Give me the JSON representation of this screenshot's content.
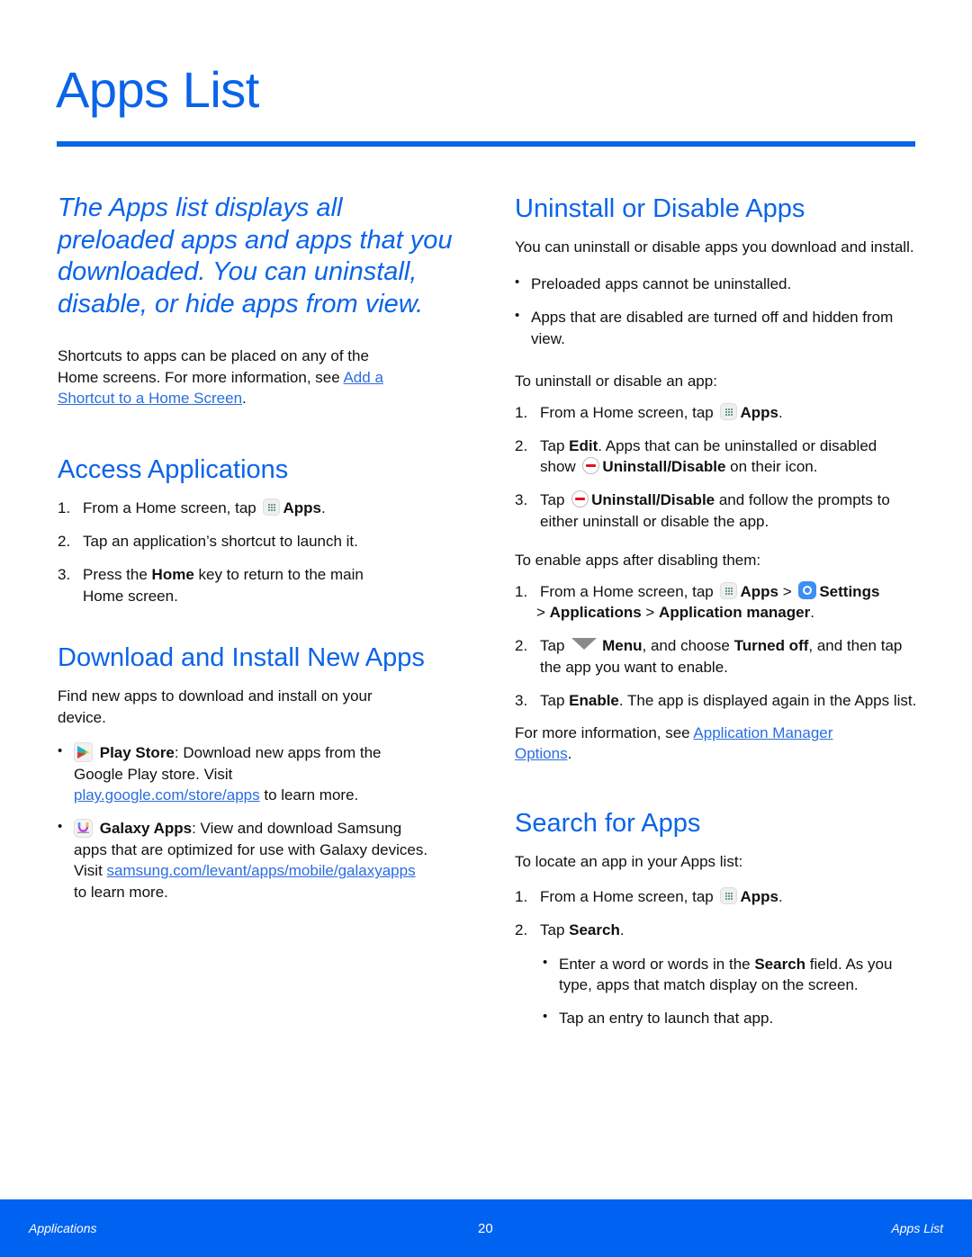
{
  "page": {
    "title": "Apps List",
    "accent_color": "#0a64e8",
    "intro": "The Apps list displays all preloaded apps and apps that you downloaded. You can uninstall, disable, or hide apps from view.",
    "shortcut_text_1": "Shortcuts to apps can be placed on any of the Home screens. For more information, see ",
    "shortcut_link": "Add a Shortcut to a Home Screen",
    "shortcut_text_2": "."
  },
  "access": {
    "heading": "Access Applications",
    "steps": [
      {
        "num": "1.",
        "pre": "From a Home screen, tap ",
        "icon": "apps-grid-icon",
        "bold": "Apps",
        "post": "."
      },
      {
        "num": "2.",
        "text": "Tap an application’s shortcut to launch it."
      },
      {
        "num": "3.",
        "pre": "Press the ",
        "bold": "Home",
        "post": " key to return to the main Home screen."
      }
    ]
  },
  "download": {
    "heading": "Download and Install New Apps",
    "text": "Find new apps to download and install on your device.",
    "items": [
      {
        "icon": "play-store-icon",
        "bold": "Play Store",
        "text": ": Download new apps from the Google Play store. Visit ",
        "link": "play.google.com/store/apps",
        "post": " to learn more."
      },
      {
        "icon": "galaxy-apps-icon",
        "bold": "Galaxy Apps",
        "text": ": View and download Samsung apps that are optimized for use with Galaxy devices. Visit ",
        "link": "samsung.com/levant/apps/mobile/galaxyapps",
        "post": " to learn more."
      }
    ]
  },
  "uninstall": {
    "heading": "Uninstall or Disable Apps",
    "text": "You can uninstall or disable apps you download and install.",
    "bullets": [
      "Preloaded apps cannot be uninstalled.",
      "Apps that are disabled are turned off and hidden from view."
    ],
    "intro_steps": "To uninstall or disable an app:",
    "steps": [
      {
        "num": "1.",
        "pre": "From a Home screen, tap ",
        "bold": "Apps",
        "post": "."
      },
      {
        "num": "2.",
        "pre": "Tap ",
        "bold": "Edit",
        "mid": ". Apps that can be uninstalled or disabled show ",
        "bold2": "Uninstall/Disable",
        "post": " on their icon."
      },
      {
        "num": "3.",
        "pre": "Tap ",
        "bold": "Uninstall/Disable",
        "post": " and follow the prompts to either uninstall or disable the app."
      }
    ],
    "enable_intro": "To enable apps after disabling them:",
    "enable_steps": [
      {
        "num": "1.",
        "pre": "From a Home screen, tap ",
        "bold": "Apps",
        "sep1": " > ",
        "bold2": "Settings",
        "sep2": " > ",
        "bold3": "Applications",
        "sep3": " > ",
        "bold4": "Application manager",
        "post": "."
      },
      {
        "num": "2.",
        "pre": "Tap ",
        "bold": "Menu",
        "mid": ", and choose ",
        "bold2": "Turned off",
        "post": ", and then tap the app you want to enable."
      },
      {
        "num": "3.",
        "pre": "Tap ",
        "bold": "Enable",
        "post": ". The app is displayed again in the Apps list."
      }
    ],
    "more_pre": "For more information, see ",
    "more_link": "Application Manager Options",
    "more_post": "."
  },
  "search": {
    "heading": "Search for Apps",
    "text": "To locate an app in your Apps list:",
    "steps": [
      {
        "num": "1.",
        "pre": "From a Home screen, tap ",
        "bold": "Apps",
        "post": "."
      },
      {
        "num": "2.",
        "pre": "Tap ",
        "bold": "Search",
        "post": "."
      }
    ],
    "sub_bullets": [
      {
        "pre": "Enter a word or words in the ",
        "bold": "Search",
        "post": " field. As you type, apps that match display on the screen."
      },
      {
        "text": "Tap an entry to launch that app."
      }
    ]
  },
  "footer": {
    "left": "Applications",
    "page_number": "20",
    "right": "Apps List",
    "color": "#0062f0"
  }
}
